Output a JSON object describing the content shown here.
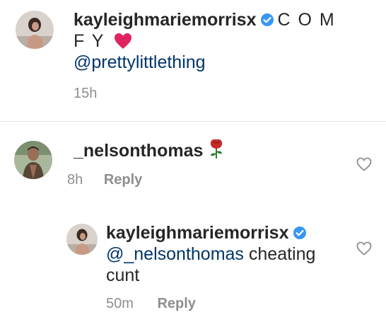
{
  "caption": {
    "username": "kayleighmariemorrisx",
    "text_line1": "C O M",
    "text_line2": "F Y",
    "mention": "@prettylittlething",
    "time": "15h",
    "avatar_icon": "profile-photo-woman"
  },
  "comments": [
    {
      "username": "_nelsonthomas",
      "emoji": "rose",
      "time": "8h",
      "reply_label": "Reply",
      "avatar_icon": "profile-photo-man"
    },
    {
      "username": "kayleighmariemorrisx",
      "mention": "@_nelsonthomas",
      "text_after_mention": "cheating",
      "text_line2": "cunt",
      "time": "50m",
      "reply_label": "Reply",
      "avatar_icon": "profile-photo-woman"
    }
  ],
  "colors": {
    "verified": "#3897f0",
    "heart": "#e0245e",
    "mention": "#003569",
    "meta": "#8e8e8e"
  }
}
